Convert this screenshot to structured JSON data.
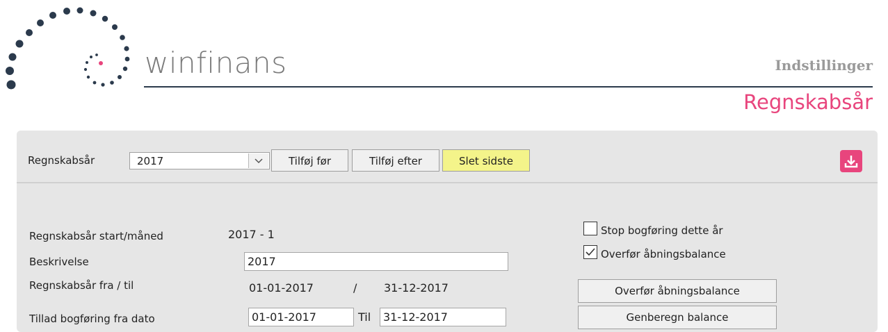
{
  "brand": {
    "name": "winfinans",
    "dot_color": "#2b3a4c",
    "accent_dot_color": "#e8457d"
  },
  "header": {
    "breadcrumb": "Indstillinger",
    "title": "Regnskabsår",
    "title_color": "#e8457d"
  },
  "toolbar": {
    "year_label": "Regnskabsår",
    "year_select": {
      "value": "2017"
    },
    "add_before_label": "Tilføj før",
    "add_after_label": "Tilføj efter",
    "delete_last_label": "Slet sidste",
    "download_icon": "download-icon"
  },
  "form": {
    "start_month_label": "Regnskabsår start/måned",
    "start_month_value": "2017 - 1",
    "description_label": "Beskrivelse",
    "description_value": "2017",
    "period_label": "Regnskabsår fra / til",
    "period_from": "01-01-2017",
    "period_separator": "/",
    "period_to": "31-12-2017",
    "allow_posting_label": "Tillad bogføring fra dato",
    "allow_posting_from": "01-01-2017",
    "allow_posting_to_label": "Til",
    "allow_posting_to": "31-12-2017"
  },
  "options": {
    "stop_posting": {
      "label": "Stop bogføring dette år",
      "checked": false
    },
    "transfer_opening": {
      "label": "Overfør åbningsbalance",
      "checked": true
    },
    "transfer_opening_button": "Overfør åbningsbalance",
    "recalc_button": "Genberegn balance"
  }
}
